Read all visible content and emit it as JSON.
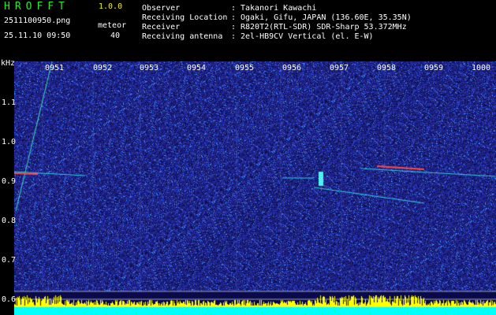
{
  "app": {
    "title": "HROFFT",
    "version": "1.0.0"
  },
  "file_name": "2511100950.png",
  "date_time": "25.11.10 09:50",
  "meteor": {
    "label": "meteor",
    "count": "40"
  },
  "info": [
    {
      "label": "Observer",
      "value": "Takanori Kawachi"
    },
    {
      "label": "Receiving Location",
      "value": "Ogaki, Gifu, JAPAN (136.60E, 35.35N)"
    },
    {
      "label": "Receiver",
      "value": "R820T2(RTL-SDR) SDR-Sharp 53.372MHz"
    },
    {
      "label": "Receiving antenna",
      "value": "2el-HB9CV Vertical (el. E-W)"
    }
  ],
  "separator": ":",
  "axis": {
    "unit": "kHz",
    "time_ticks": [
      "0951",
      "0952",
      "0953",
      "0954",
      "0955",
      "0956",
      "0957",
      "0958",
      "0959",
      "1000"
    ],
    "freq_ticks": [
      "1.1",
      "1.0",
      "0.9",
      "0.8",
      "0.7",
      "0.6"
    ]
  },
  "colors": {
    "background": "#000000",
    "label_green": "#2ee62e",
    "label_yellow": "#f2f200",
    "noise_dark": "#0a0a5a",
    "noise_blue": "#2a3cff",
    "trace_cyan": "#33e6e6",
    "trace_red": "#ff4040",
    "level_yellow": "#ffff00",
    "level_cyan": "#00ffff"
  }
}
